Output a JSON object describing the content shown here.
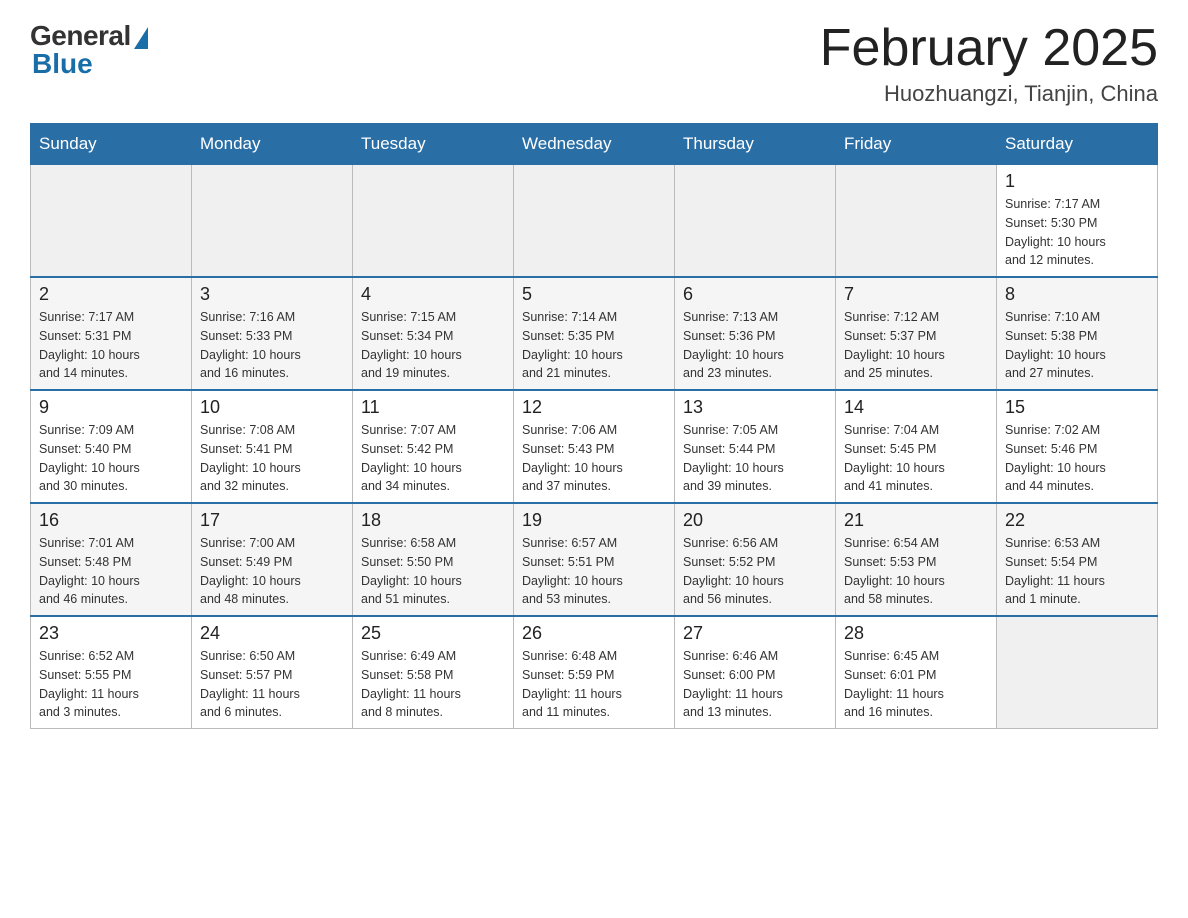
{
  "header": {
    "logo_general": "General",
    "logo_blue": "Blue",
    "month_title": "February 2025",
    "location": "Huozhuangzi, Tianjin, China"
  },
  "weekdays": [
    "Sunday",
    "Monday",
    "Tuesday",
    "Wednesday",
    "Thursday",
    "Friday",
    "Saturday"
  ],
  "weeks": [
    [
      {
        "day": "",
        "info": ""
      },
      {
        "day": "",
        "info": ""
      },
      {
        "day": "",
        "info": ""
      },
      {
        "day": "",
        "info": ""
      },
      {
        "day": "",
        "info": ""
      },
      {
        "day": "",
        "info": ""
      },
      {
        "day": "1",
        "info": "Sunrise: 7:17 AM\nSunset: 5:30 PM\nDaylight: 10 hours\nand 12 minutes."
      }
    ],
    [
      {
        "day": "2",
        "info": "Sunrise: 7:17 AM\nSunset: 5:31 PM\nDaylight: 10 hours\nand 14 minutes."
      },
      {
        "day": "3",
        "info": "Sunrise: 7:16 AM\nSunset: 5:33 PM\nDaylight: 10 hours\nand 16 minutes."
      },
      {
        "day": "4",
        "info": "Sunrise: 7:15 AM\nSunset: 5:34 PM\nDaylight: 10 hours\nand 19 minutes."
      },
      {
        "day": "5",
        "info": "Sunrise: 7:14 AM\nSunset: 5:35 PM\nDaylight: 10 hours\nand 21 minutes."
      },
      {
        "day": "6",
        "info": "Sunrise: 7:13 AM\nSunset: 5:36 PM\nDaylight: 10 hours\nand 23 minutes."
      },
      {
        "day": "7",
        "info": "Sunrise: 7:12 AM\nSunset: 5:37 PM\nDaylight: 10 hours\nand 25 minutes."
      },
      {
        "day": "8",
        "info": "Sunrise: 7:10 AM\nSunset: 5:38 PM\nDaylight: 10 hours\nand 27 minutes."
      }
    ],
    [
      {
        "day": "9",
        "info": "Sunrise: 7:09 AM\nSunset: 5:40 PM\nDaylight: 10 hours\nand 30 minutes."
      },
      {
        "day": "10",
        "info": "Sunrise: 7:08 AM\nSunset: 5:41 PM\nDaylight: 10 hours\nand 32 minutes."
      },
      {
        "day": "11",
        "info": "Sunrise: 7:07 AM\nSunset: 5:42 PM\nDaylight: 10 hours\nand 34 minutes."
      },
      {
        "day": "12",
        "info": "Sunrise: 7:06 AM\nSunset: 5:43 PM\nDaylight: 10 hours\nand 37 minutes."
      },
      {
        "day": "13",
        "info": "Sunrise: 7:05 AM\nSunset: 5:44 PM\nDaylight: 10 hours\nand 39 minutes."
      },
      {
        "day": "14",
        "info": "Sunrise: 7:04 AM\nSunset: 5:45 PM\nDaylight: 10 hours\nand 41 minutes."
      },
      {
        "day": "15",
        "info": "Sunrise: 7:02 AM\nSunset: 5:46 PM\nDaylight: 10 hours\nand 44 minutes."
      }
    ],
    [
      {
        "day": "16",
        "info": "Sunrise: 7:01 AM\nSunset: 5:48 PM\nDaylight: 10 hours\nand 46 minutes."
      },
      {
        "day": "17",
        "info": "Sunrise: 7:00 AM\nSunset: 5:49 PM\nDaylight: 10 hours\nand 48 minutes."
      },
      {
        "day": "18",
        "info": "Sunrise: 6:58 AM\nSunset: 5:50 PM\nDaylight: 10 hours\nand 51 minutes."
      },
      {
        "day": "19",
        "info": "Sunrise: 6:57 AM\nSunset: 5:51 PM\nDaylight: 10 hours\nand 53 minutes."
      },
      {
        "day": "20",
        "info": "Sunrise: 6:56 AM\nSunset: 5:52 PM\nDaylight: 10 hours\nand 56 minutes."
      },
      {
        "day": "21",
        "info": "Sunrise: 6:54 AM\nSunset: 5:53 PM\nDaylight: 10 hours\nand 58 minutes."
      },
      {
        "day": "22",
        "info": "Sunrise: 6:53 AM\nSunset: 5:54 PM\nDaylight: 11 hours\nand 1 minute."
      }
    ],
    [
      {
        "day": "23",
        "info": "Sunrise: 6:52 AM\nSunset: 5:55 PM\nDaylight: 11 hours\nand 3 minutes."
      },
      {
        "day": "24",
        "info": "Sunrise: 6:50 AM\nSunset: 5:57 PM\nDaylight: 11 hours\nand 6 minutes."
      },
      {
        "day": "25",
        "info": "Sunrise: 6:49 AM\nSunset: 5:58 PM\nDaylight: 11 hours\nand 8 minutes."
      },
      {
        "day": "26",
        "info": "Sunrise: 6:48 AM\nSunset: 5:59 PM\nDaylight: 11 hours\nand 11 minutes."
      },
      {
        "day": "27",
        "info": "Sunrise: 6:46 AM\nSunset: 6:00 PM\nDaylight: 11 hours\nand 13 minutes."
      },
      {
        "day": "28",
        "info": "Sunrise: 6:45 AM\nSunset: 6:01 PM\nDaylight: 11 hours\nand 16 minutes."
      },
      {
        "day": "",
        "info": ""
      }
    ]
  ]
}
